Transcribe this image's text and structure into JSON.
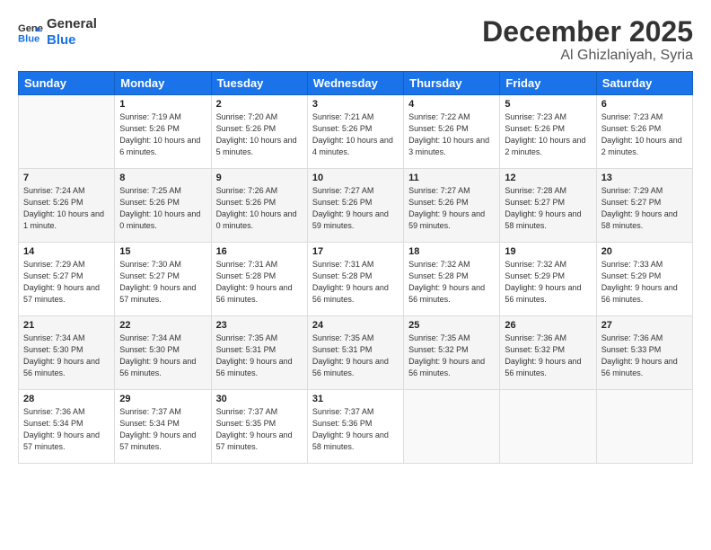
{
  "logo": {
    "line1": "General",
    "line2": "Blue"
  },
  "title": "December 2025",
  "location": "Al Ghizlaniyah, Syria",
  "days": [
    "Sunday",
    "Monday",
    "Tuesday",
    "Wednesday",
    "Thursday",
    "Friday",
    "Saturday"
  ],
  "weeks": [
    [
      {
        "date": "",
        "sunrise": "",
        "sunset": "",
        "daylight": ""
      },
      {
        "date": "1",
        "sunrise": "Sunrise: 7:19 AM",
        "sunset": "Sunset: 5:26 PM",
        "daylight": "Daylight: 10 hours and 6 minutes."
      },
      {
        "date": "2",
        "sunrise": "Sunrise: 7:20 AM",
        "sunset": "Sunset: 5:26 PM",
        "daylight": "Daylight: 10 hours and 5 minutes."
      },
      {
        "date": "3",
        "sunrise": "Sunrise: 7:21 AM",
        "sunset": "Sunset: 5:26 PM",
        "daylight": "Daylight: 10 hours and 4 minutes."
      },
      {
        "date": "4",
        "sunrise": "Sunrise: 7:22 AM",
        "sunset": "Sunset: 5:26 PM",
        "daylight": "Daylight: 10 hours and 3 minutes."
      },
      {
        "date": "5",
        "sunrise": "Sunrise: 7:23 AM",
        "sunset": "Sunset: 5:26 PM",
        "daylight": "Daylight: 10 hours and 2 minutes."
      },
      {
        "date": "6",
        "sunrise": "Sunrise: 7:23 AM",
        "sunset": "Sunset: 5:26 PM",
        "daylight": "Daylight: 10 hours and 2 minutes."
      }
    ],
    [
      {
        "date": "7",
        "sunrise": "Sunrise: 7:24 AM",
        "sunset": "Sunset: 5:26 PM",
        "daylight": "Daylight: 10 hours and 1 minute."
      },
      {
        "date": "8",
        "sunrise": "Sunrise: 7:25 AM",
        "sunset": "Sunset: 5:26 PM",
        "daylight": "Daylight: 10 hours and 0 minutes."
      },
      {
        "date": "9",
        "sunrise": "Sunrise: 7:26 AM",
        "sunset": "Sunset: 5:26 PM",
        "daylight": "Daylight: 10 hours and 0 minutes."
      },
      {
        "date": "10",
        "sunrise": "Sunrise: 7:27 AM",
        "sunset": "Sunset: 5:26 PM",
        "daylight": "Daylight: 9 hours and 59 minutes."
      },
      {
        "date": "11",
        "sunrise": "Sunrise: 7:27 AM",
        "sunset": "Sunset: 5:26 PM",
        "daylight": "Daylight: 9 hours and 59 minutes."
      },
      {
        "date": "12",
        "sunrise": "Sunrise: 7:28 AM",
        "sunset": "Sunset: 5:27 PM",
        "daylight": "Daylight: 9 hours and 58 minutes."
      },
      {
        "date": "13",
        "sunrise": "Sunrise: 7:29 AM",
        "sunset": "Sunset: 5:27 PM",
        "daylight": "Daylight: 9 hours and 58 minutes."
      }
    ],
    [
      {
        "date": "14",
        "sunrise": "Sunrise: 7:29 AM",
        "sunset": "Sunset: 5:27 PM",
        "daylight": "Daylight: 9 hours and 57 minutes."
      },
      {
        "date": "15",
        "sunrise": "Sunrise: 7:30 AM",
        "sunset": "Sunset: 5:27 PM",
        "daylight": "Daylight: 9 hours and 57 minutes."
      },
      {
        "date": "16",
        "sunrise": "Sunrise: 7:31 AM",
        "sunset": "Sunset: 5:28 PM",
        "daylight": "Daylight: 9 hours and 56 minutes."
      },
      {
        "date": "17",
        "sunrise": "Sunrise: 7:31 AM",
        "sunset": "Sunset: 5:28 PM",
        "daylight": "Daylight: 9 hours and 56 minutes."
      },
      {
        "date": "18",
        "sunrise": "Sunrise: 7:32 AM",
        "sunset": "Sunset: 5:28 PM",
        "daylight": "Daylight: 9 hours and 56 minutes."
      },
      {
        "date": "19",
        "sunrise": "Sunrise: 7:32 AM",
        "sunset": "Sunset: 5:29 PM",
        "daylight": "Daylight: 9 hours and 56 minutes."
      },
      {
        "date": "20",
        "sunrise": "Sunrise: 7:33 AM",
        "sunset": "Sunset: 5:29 PM",
        "daylight": "Daylight: 9 hours and 56 minutes."
      }
    ],
    [
      {
        "date": "21",
        "sunrise": "Sunrise: 7:34 AM",
        "sunset": "Sunset: 5:30 PM",
        "daylight": "Daylight: 9 hours and 56 minutes."
      },
      {
        "date": "22",
        "sunrise": "Sunrise: 7:34 AM",
        "sunset": "Sunset: 5:30 PM",
        "daylight": "Daylight: 9 hours and 56 minutes."
      },
      {
        "date": "23",
        "sunrise": "Sunrise: 7:35 AM",
        "sunset": "Sunset: 5:31 PM",
        "daylight": "Daylight: 9 hours and 56 minutes."
      },
      {
        "date": "24",
        "sunrise": "Sunrise: 7:35 AM",
        "sunset": "Sunset: 5:31 PM",
        "daylight": "Daylight: 9 hours and 56 minutes."
      },
      {
        "date": "25",
        "sunrise": "Sunrise: 7:35 AM",
        "sunset": "Sunset: 5:32 PM",
        "daylight": "Daylight: 9 hours and 56 minutes."
      },
      {
        "date": "26",
        "sunrise": "Sunrise: 7:36 AM",
        "sunset": "Sunset: 5:32 PM",
        "daylight": "Daylight: 9 hours and 56 minutes."
      },
      {
        "date": "27",
        "sunrise": "Sunrise: 7:36 AM",
        "sunset": "Sunset: 5:33 PM",
        "daylight": "Daylight: 9 hours and 56 minutes."
      }
    ],
    [
      {
        "date": "28",
        "sunrise": "Sunrise: 7:36 AM",
        "sunset": "Sunset: 5:34 PM",
        "daylight": "Daylight: 9 hours and 57 minutes."
      },
      {
        "date": "29",
        "sunrise": "Sunrise: 7:37 AM",
        "sunset": "Sunset: 5:34 PM",
        "daylight": "Daylight: 9 hours and 57 minutes."
      },
      {
        "date": "30",
        "sunrise": "Sunrise: 7:37 AM",
        "sunset": "Sunset: 5:35 PM",
        "daylight": "Daylight: 9 hours and 57 minutes."
      },
      {
        "date": "31",
        "sunrise": "Sunrise: 7:37 AM",
        "sunset": "Sunset: 5:36 PM",
        "daylight": "Daylight: 9 hours and 58 minutes."
      },
      {
        "date": "",
        "sunrise": "",
        "sunset": "",
        "daylight": ""
      },
      {
        "date": "",
        "sunrise": "",
        "sunset": "",
        "daylight": ""
      },
      {
        "date": "",
        "sunrise": "",
        "sunset": "",
        "daylight": ""
      }
    ]
  ]
}
